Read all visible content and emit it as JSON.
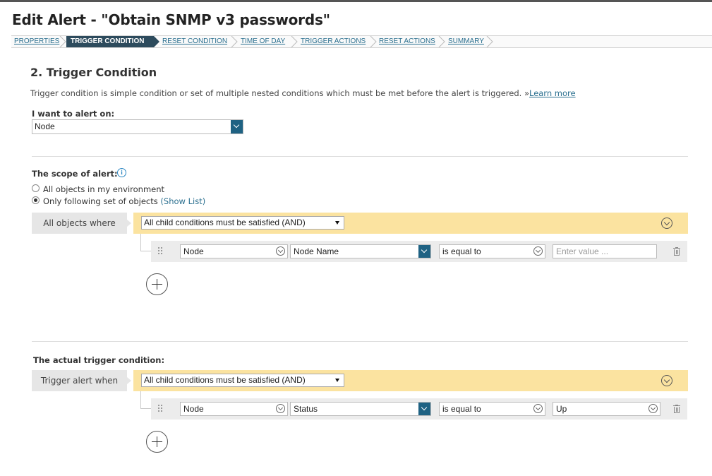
{
  "page": {
    "title": "Edit Alert - \"Obtain SNMP v3 passwords\""
  },
  "wizard": {
    "steps": [
      {
        "label": "PROPERTIES",
        "active": false
      },
      {
        "label": "TRIGGER CONDITION",
        "active": true
      },
      {
        "label": "RESET CONDITION",
        "active": false
      },
      {
        "label": "TIME OF DAY",
        "active": false
      },
      {
        "label": "TRIGGER ACTIONS",
        "active": false
      },
      {
        "label": "RESET ACTIONS",
        "active": false
      },
      {
        "label": "SUMMARY",
        "active": false
      }
    ]
  },
  "section": {
    "title": "2. Trigger Condition",
    "description": "Trigger condition is simple condition or set of multiple nested conditions which must be met before the alert is triggered.",
    "learn_more_prefix": "»",
    "learn_more": "Learn more"
  },
  "alert_on": {
    "label": "I want to alert on:",
    "value": "Node"
  },
  "scope": {
    "label": "The scope of alert:",
    "info_icon": "info-icon",
    "options": [
      {
        "label": "All objects in my environment",
        "checked": false
      },
      {
        "label": "Only following set of objects",
        "checked": true
      }
    ],
    "show_list": "(Show List)",
    "group_label": "All objects where",
    "group_operator": "All child conditions must be satisfied (AND)",
    "condition": {
      "object": "Node",
      "field": "Node Name",
      "operator": "is equal to",
      "value_placeholder": "Enter value ..."
    }
  },
  "trigger": {
    "label": "The actual trigger condition:",
    "group_label": "Trigger alert when",
    "group_operator": "All child conditions must be satisfied (AND)",
    "condition": {
      "object": "Node",
      "field": "Status",
      "operator": "is equal to",
      "value": "Up"
    }
  },
  "colors": {
    "accent": "#1f6283",
    "active_step": "#2d4b5d",
    "group_bar": "#fbe3a0",
    "link": "#2a6f8f"
  }
}
